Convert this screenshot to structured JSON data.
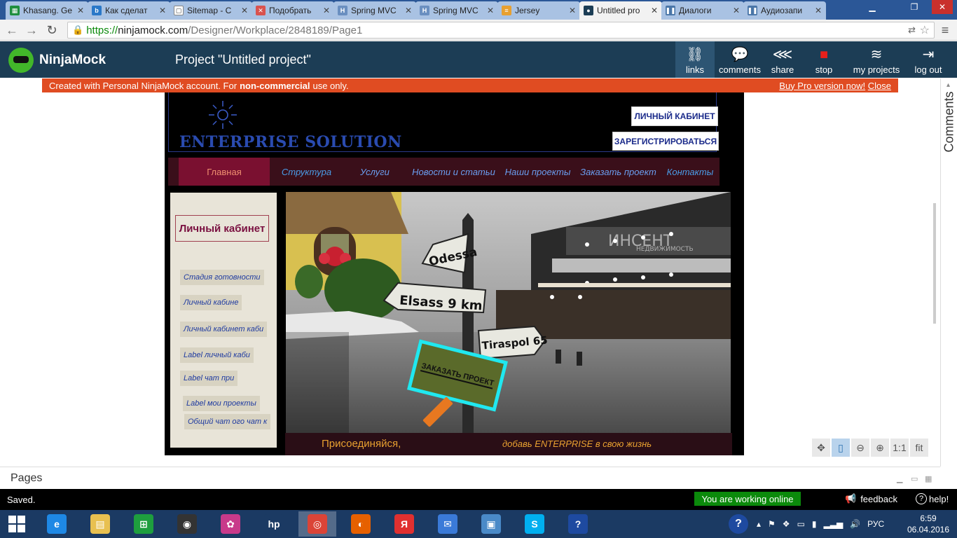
{
  "browser": {
    "tabs": [
      {
        "label": "Khasang. Ge",
        "icon_color": "#1e8e3e",
        "glyph": "▦"
      },
      {
        "label": "Как сделат",
        "icon_color": "#2a78c8",
        "glyph": "b"
      },
      {
        "label": "Sitemap - C",
        "icon_color": "#ffffff",
        "glyph": "▢"
      },
      {
        "label": "Подобрать",
        "icon_color": "#d9534f",
        "glyph": "✕"
      },
      {
        "label": "Spring MVC",
        "icon_color": "#6a8fc0",
        "glyph": "H"
      },
      {
        "label": "Spring MVC",
        "icon_color": "#6a8fc0",
        "glyph": "H"
      },
      {
        "label": "Jersey",
        "icon_color": "#e8a030",
        "glyph": "≡"
      },
      {
        "label": "Untitled pro",
        "icon_color": "#1c3d55",
        "glyph": "●"
      },
      {
        "label": "Диалоги",
        "icon_color": "#4a76a8",
        "glyph": "❚❚"
      },
      {
        "label": "Аудиозапи",
        "icon_color": "#4a76a8",
        "glyph": "❚❚"
      }
    ],
    "active_tab_index": 7,
    "url": {
      "scheme": "https://",
      "host": "ninjamock.com",
      "path": "/Designer/Workplace/2848189/Page1"
    }
  },
  "app": {
    "logo_text": "NinjaMock",
    "project_title": "Project \"Untitled project\"",
    "header_buttons": [
      {
        "label": "links",
        "icon": "link-icon",
        "glyph": "⛓"
      },
      {
        "label": "comments",
        "icon": "comments-icon",
        "glyph": "💬"
      },
      {
        "label": "share",
        "icon": "share-icon",
        "glyph": "⋘"
      },
      {
        "label": "stop",
        "icon": "stop-icon",
        "glyph": "■"
      },
      {
        "label": "my projects",
        "icon": "layers-icon",
        "glyph": "≋"
      },
      {
        "label": "log out",
        "icon": "logout-icon",
        "glyph": "⇥"
      }
    ],
    "notice": {
      "prefix": "Created with Personal NinjaMock account. For",
      "bold": "non-commercial",
      "suffix": "use only.",
      "buy_link": "Buy Pro version now!",
      "close_link": "Close"
    }
  },
  "mockup": {
    "brand": "ENTERPRISE SOLUTION",
    "account_button": "ЛИЧНЫЙ КАБИНЕТ",
    "register_button": "ЗАРЕГИСТРИРОВАТЬСЯ",
    "menu": [
      "Главная",
      "Структура",
      "Услуги",
      "Новости и статьи",
      "Наши проекты",
      "Заказать проект",
      "Контакты"
    ],
    "sidebar_title": "Личный кабинет",
    "sidebar_links": [
      "Стадия готовности",
      "Личный кабине",
      "Личный кабинет каби",
      "Label личный каби",
      "Label чат при",
      "Label мои проекты",
      "Общий чат ого чат к"
    ],
    "hero": {
      "signs": [
        "Odessa",
        "Elsass 9 km",
        "Tiraspol 65"
      ],
      "order_sign": "ЗАКАЗАТЬ ПРОЕКТ",
      "watermark": "ИНСЕНТ",
      "watermark_sub": "НЕДВИЖИМОСТЬ"
    },
    "footer_left": "Присоединяйся,",
    "footer_right": "добавь ENTERPRISE в свою жизнь"
  },
  "zoom_controls": [
    {
      "name": "pan-icon",
      "glyph": "✥"
    },
    {
      "name": "device-icon",
      "glyph": "▯"
    },
    {
      "name": "zoom-out-icon",
      "glyph": "⊖"
    },
    {
      "name": "zoom-in-icon",
      "glyph": "⊕"
    },
    {
      "name": "actual-size-button",
      "glyph": "1:1"
    },
    {
      "name": "fit-button",
      "glyph": "fit"
    }
  ],
  "comments_label": "Comments",
  "pages_label": "Pages",
  "status": {
    "saved": "Saved.",
    "online": "You are working online",
    "feedback": "feedback",
    "help": "help!"
  },
  "taskbar": {
    "apps": [
      {
        "name": "internet-explorer-icon",
        "color": "#1e88e5",
        "glyph": "e"
      },
      {
        "name": "file-explorer-icon",
        "color": "#e8c050",
        "glyph": "▤"
      },
      {
        "name": "store-icon",
        "color": "#1e9e3e",
        "glyph": "⊞"
      },
      {
        "name": "camera-app-icon",
        "color": "#333333",
        "glyph": "◉"
      },
      {
        "name": "paint-app-icon",
        "color": "#c83a8a",
        "glyph": "✿"
      },
      {
        "name": "hp-icon",
        "color": "#1b3a63",
        "glyph": "hp"
      },
      {
        "name": "chrome-icon",
        "color": "#db4437",
        "glyph": "◎"
      },
      {
        "name": "firefox-icon",
        "color": "#e66000",
        "glyph": "◐"
      },
      {
        "name": "yandex-icon",
        "color": "#e03030",
        "glyph": "Я"
      },
      {
        "name": "mail-icon",
        "color": "#3a7ad8",
        "glyph": "✉"
      },
      {
        "name": "photos-icon",
        "color": "#4a8ac8",
        "glyph": "▣"
      },
      {
        "name": "skype-icon",
        "color": "#00aff0",
        "glyph": "S"
      },
      {
        "name": "help-app-icon",
        "color": "#1e4aa0",
        "glyph": "?"
      }
    ],
    "tray_lang": "РУС",
    "time": "6:59",
    "date": "06.04.2016"
  }
}
